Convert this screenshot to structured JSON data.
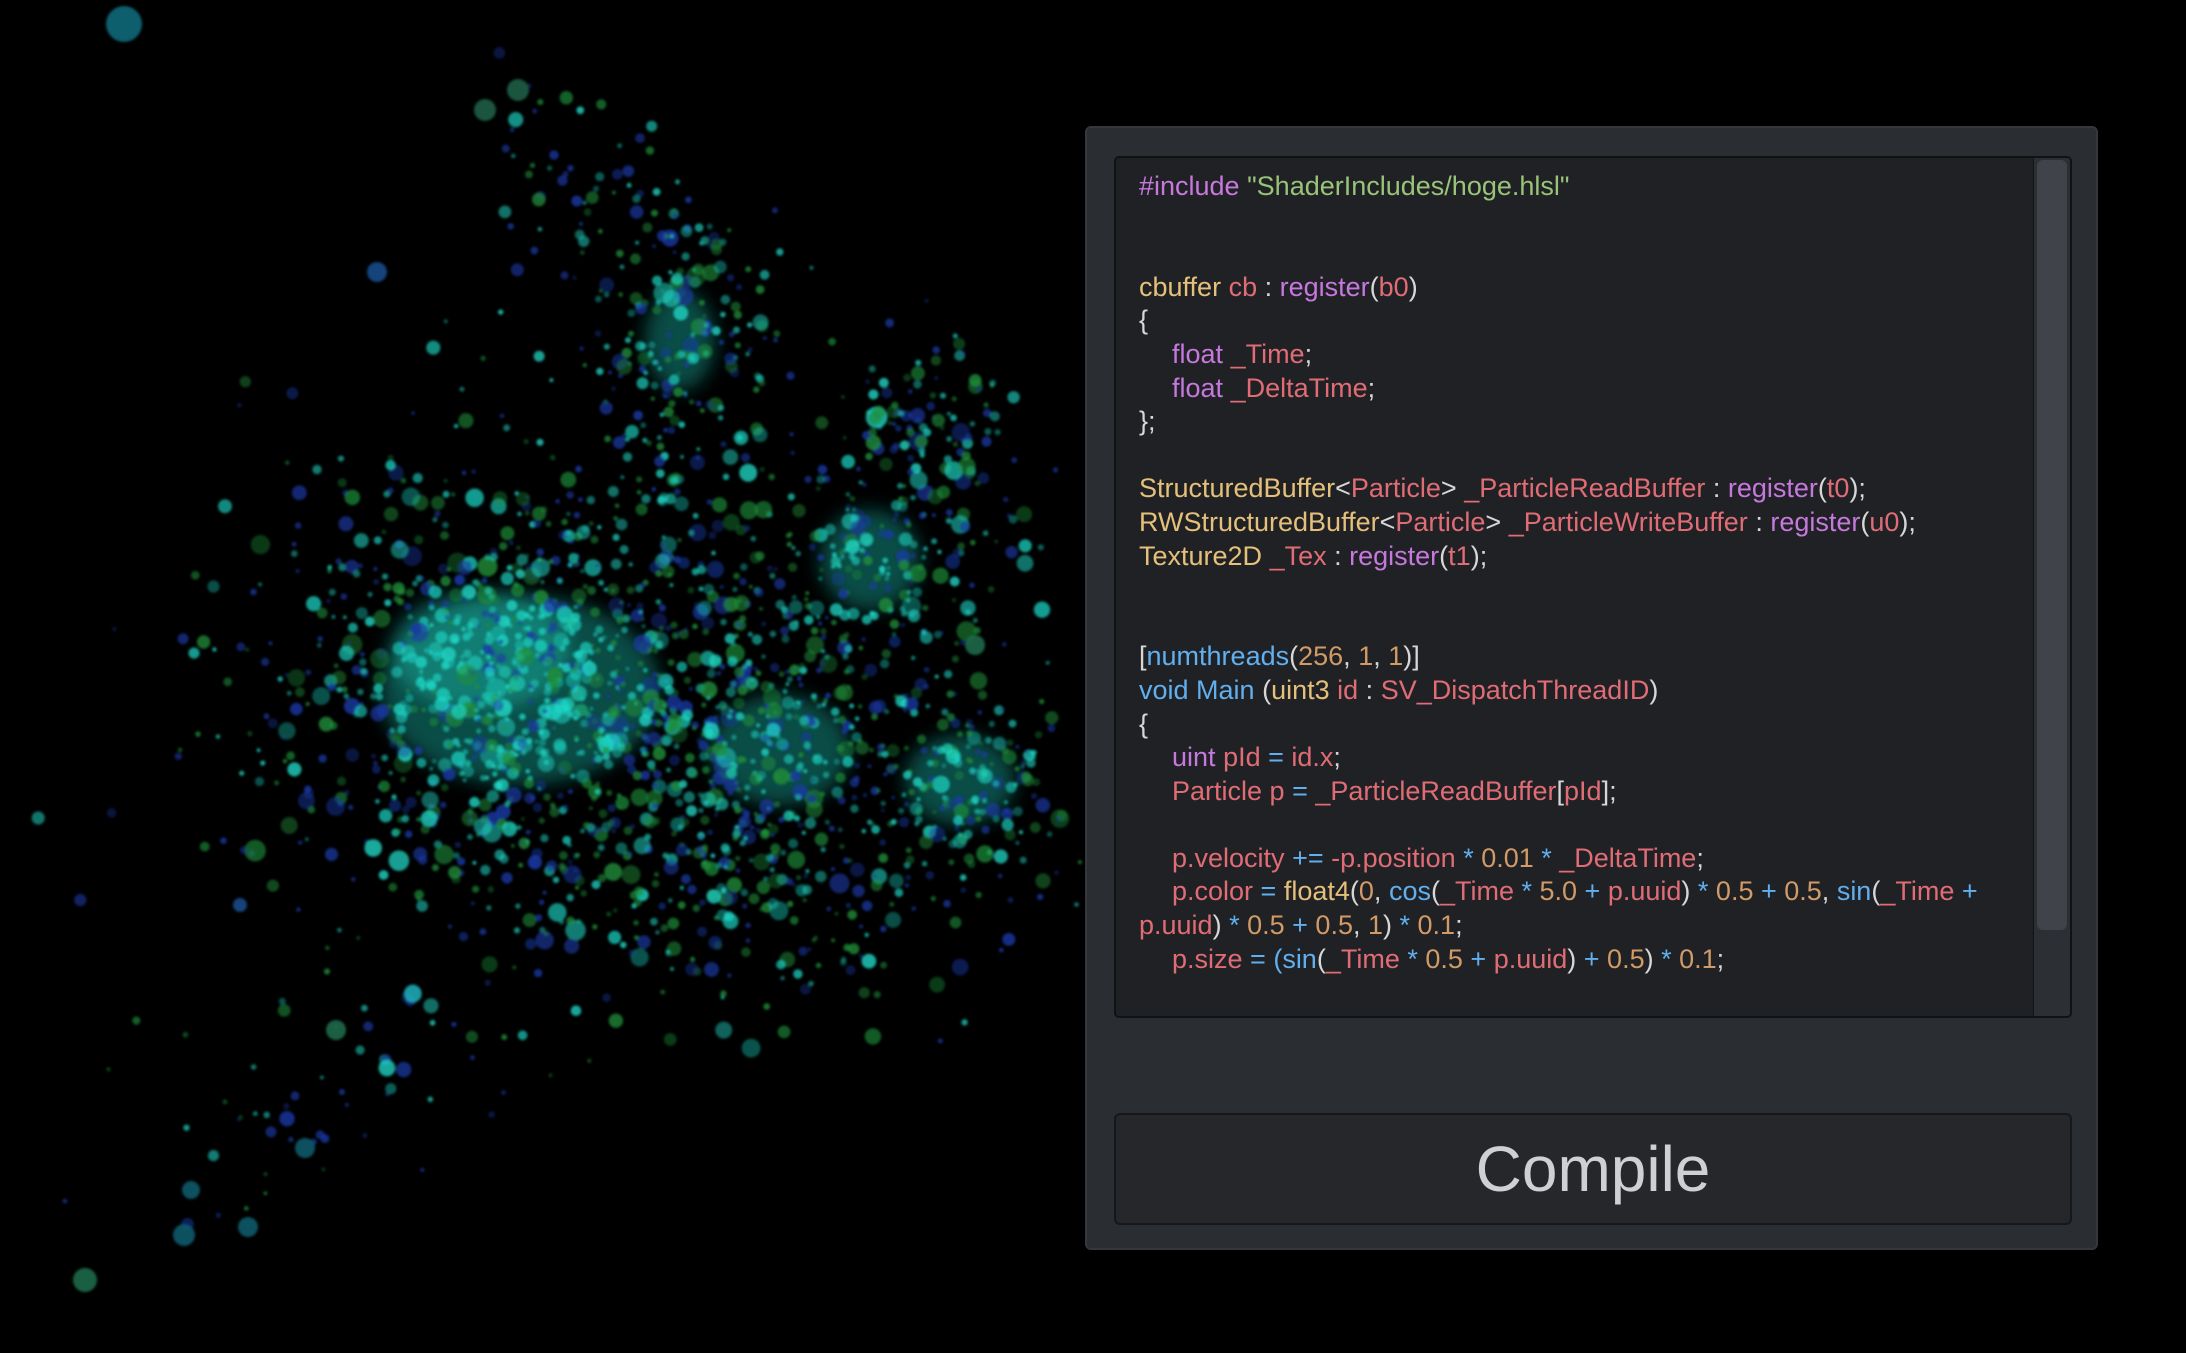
{
  "colors": {
    "background": "#000000",
    "panel": "#2a2d31",
    "editor": "#1f2124",
    "default_text": "#d7d7d7",
    "preprocessor": "#c678dd",
    "string": "#98c379",
    "type": "#e5c07b",
    "identifier": "#e06c75",
    "function": "#61afef",
    "number": "#d19a66",
    "particle_cyan": "#1fd9c8",
    "particle_green": "#1f8f3a",
    "particle_blue": "#1a3aa8"
  },
  "editor": {
    "lines": [
      [
        [
          "#include",
          "pre"
        ],
        [
          " ",
          "def"
        ],
        [
          "\"ShaderIncludes/hoge.hlsl\"",
          "str"
        ]
      ],
      [],
      [],
      [
        [
          "cbuffer",
          "typ"
        ],
        [
          " ",
          "def"
        ],
        [
          "cb",
          "id"
        ],
        [
          " : ",
          "def"
        ],
        [
          "register",
          "pre"
        ],
        [
          "(",
          "def"
        ],
        [
          "b0",
          "id"
        ],
        [
          ")",
          "def"
        ]
      ],
      [
        [
          "{",
          "def"
        ]
      ],
      [
        [
          "\t",
          "ind"
        ],
        [
          "float",
          "pre"
        ],
        [
          " ",
          "def"
        ],
        [
          "_Time",
          "id"
        ],
        [
          ";",
          "def"
        ]
      ],
      [
        [
          "\t",
          "ind"
        ],
        [
          "float",
          "pre"
        ],
        [
          " ",
          "def"
        ],
        [
          "_DeltaTime",
          "id"
        ],
        [
          ";",
          "def"
        ]
      ],
      [
        [
          "};",
          "def"
        ]
      ],
      [],
      [
        [
          "StructuredBuffer",
          "typ"
        ],
        [
          "<",
          "def"
        ],
        [
          "Particle",
          "id"
        ],
        [
          "> ",
          "def"
        ],
        [
          "_ParticleReadBuffer",
          "id"
        ],
        [
          " : ",
          "def"
        ],
        [
          "register",
          "pre"
        ],
        [
          "(",
          "def"
        ],
        [
          "t0",
          "id"
        ],
        [
          ");",
          "def"
        ]
      ],
      [
        [
          "RWStructuredBuffer",
          "typ"
        ],
        [
          "<",
          "def"
        ],
        [
          "Particle",
          "id"
        ],
        [
          "> ",
          "def"
        ],
        [
          "_ParticleWriteBuffer",
          "id"
        ],
        [
          " : ",
          "def"
        ],
        [
          "register",
          "pre"
        ],
        [
          "(",
          "def"
        ],
        [
          "u0",
          "id"
        ],
        [
          ");",
          "def"
        ]
      ],
      [
        [
          "Texture2D",
          "typ"
        ],
        [
          " ",
          "def"
        ],
        [
          "_Tex",
          "id"
        ],
        [
          " : ",
          "def"
        ],
        [
          "register",
          "pre"
        ],
        [
          "(",
          "def"
        ],
        [
          "t1",
          "id"
        ],
        [
          ");",
          "def"
        ]
      ],
      [],
      [],
      [
        [
          "[",
          "def"
        ],
        [
          "numthreads",
          "fn"
        ],
        [
          "(",
          "def"
        ],
        [
          "256",
          "num"
        ],
        [
          ", ",
          "def"
        ],
        [
          "1",
          "num"
        ],
        [
          ", ",
          "def"
        ],
        [
          "1",
          "num"
        ],
        [
          ")]",
          "def"
        ]
      ],
      [
        [
          "void",
          "fn"
        ],
        [
          " ",
          "def"
        ],
        [
          "Main",
          "fn"
        ],
        [
          " (",
          "def"
        ],
        [
          "uint3",
          "typ"
        ],
        [
          " ",
          "def"
        ],
        [
          "id",
          "id"
        ],
        [
          " : ",
          "def"
        ],
        [
          "SV_DispatchThreadID",
          "id"
        ],
        [
          ")",
          "def"
        ]
      ],
      [
        [
          "{",
          "def"
        ]
      ],
      [
        [
          "\t",
          "ind"
        ],
        [
          "uint",
          "pre"
        ],
        [
          " ",
          "def"
        ],
        [
          "pId",
          "id"
        ],
        [
          " = ",
          "fn"
        ],
        [
          "id.x",
          "id"
        ],
        [
          ";",
          "def"
        ]
      ],
      [
        [
          "\t",
          "ind"
        ],
        [
          "Particle p",
          "id"
        ],
        [
          " = ",
          "fn"
        ],
        [
          "_ParticleReadBuffer",
          "id"
        ],
        [
          "[",
          "def"
        ],
        [
          "pId",
          "id"
        ],
        [
          "];",
          "def"
        ]
      ],
      [],
      [
        [
          "\t",
          "ind"
        ],
        [
          "p.velocity",
          "id"
        ],
        [
          " += ",
          "fn"
        ],
        [
          "-p.position",
          "id"
        ],
        [
          " * ",
          "fn"
        ],
        [
          "0.01",
          "num"
        ],
        [
          " * ",
          "fn"
        ],
        [
          "_DeltaTime",
          "id"
        ],
        [
          ";",
          "def"
        ]
      ],
      [
        [
          "\t",
          "ind"
        ],
        [
          "p.color",
          "id"
        ],
        [
          " = ",
          "fn"
        ],
        [
          "float4",
          "typ"
        ],
        [
          "(",
          "def"
        ],
        [
          "0",
          "num"
        ],
        [
          ", ",
          "def"
        ],
        [
          "cos",
          "fn"
        ],
        [
          "(",
          "def"
        ],
        [
          "_Time",
          "id"
        ],
        [
          " * ",
          "fn"
        ],
        [
          "5.0",
          "num"
        ],
        [
          " + ",
          "fn"
        ],
        [
          "p.uuid",
          "id"
        ],
        [
          ") ",
          "def"
        ],
        [
          "* ",
          "fn"
        ],
        [
          "0.5",
          "num"
        ],
        [
          " + ",
          "fn"
        ],
        [
          "0.5",
          "num"
        ],
        [
          ", ",
          "def"
        ],
        [
          "sin",
          "fn"
        ],
        [
          "(",
          "def"
        ],
        [
          "_Time",
          "id"
        ],
        [
          " + ",
          "fn"
        ],
        [
          "p.uuid",
          "id"
        ],
        [
          ") ",
          "def"
        ],
        [
          "* ",
          "fn"
        ],
        [
          "0.5",
          "num"
        ],
        [
          " + ",
          "fn"
        ],
        [
          "0.5",
          "num"
        ],
        [
          ", ",
          "def"
        ],
        [
          "1",
          "num"
        ],
        [
          ") ",
          "def"
        ],
        [
          "* ",
          "fn"
        ],
        [
          "0.1",
          "num"
        ],
        [
          ";",
          "def"
        ]
      ],
      [
        [
          "\t",
          "ind"
        ],
        [
          "p.size",
          "id"
        ],
        [
          " = (",
          "fn"
        ],
        [
          "sin",
          "fn"
        ],
        [
          "(",
          "def"
        ],
        [
          "_Time",
          "id"
        ],
        [
          " * ",
          "fn"
        ],
        [
          "0.5",
          "num"
        ],
        [
          " + ",
          "fn"
        ],
        [
          "p.uuid",
          "id"
        ],
        [
          ") ",
          "def"
        ],
        [
          "+ ",
          "fn"
        ],
        [
          "0.5",
          "num"
        ],
        [
          ") ",
          "def"
        ],
        [
          "* ",
          "fn"
        ],
        [
          "0.1",
          "num"
        ],
        [
          ";",
          "def"
        ]
      ]
    ]
  },
  "compile_button": {
    "label": "Compile"
  }
}
